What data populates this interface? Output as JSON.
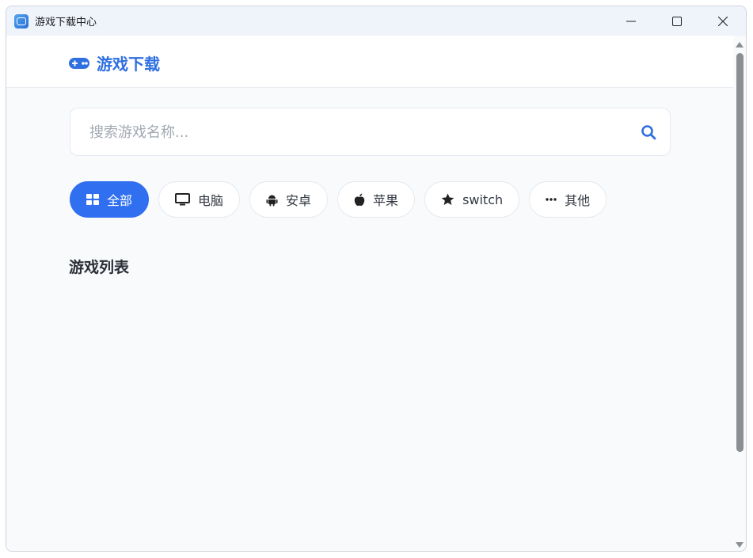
{
  "window": {
    "title": "游戏下载中心",
    "controls": [
      "minimize-icon",
      "maximize-icon",
      "close-icon"
    ]
  },
  "header": {
    "brand_icon": "gamepad-icon",
    "brand_title": "游戏下载"
  },
  "search": {
    "placeholder": "搜索游戏名称...",
    "value": "",
    "icon": "search-icon"
  },
  "filters": [
    {
      "label": "全部",
      "icon": "grid-icon",
      "active": true
    },
    {
      "label": "电脑",
      "icon": "monitor-icon",
      "active": false
    },
    {
      "label": "安卓",
      "icon": "android-icon",
      "active": false
    },
    {
      "label": "苹果",
      "icon": "apple-icon",
      "active": false
    },
    {
      "label": "switch",
      "icon": "star-icon",
      "active": false
    },
    {
      "label": "其他",
      "icon": "ellipsis-icon",
      "active": false
    }
  ],
  "list": {
    "title": "游戏列表",
    "items": []
  },
  "colors": {
    "accent": "#2f6ff0",
    "brand": "#2f6fe0",
    "background": "#f8fafc"
  }
}
